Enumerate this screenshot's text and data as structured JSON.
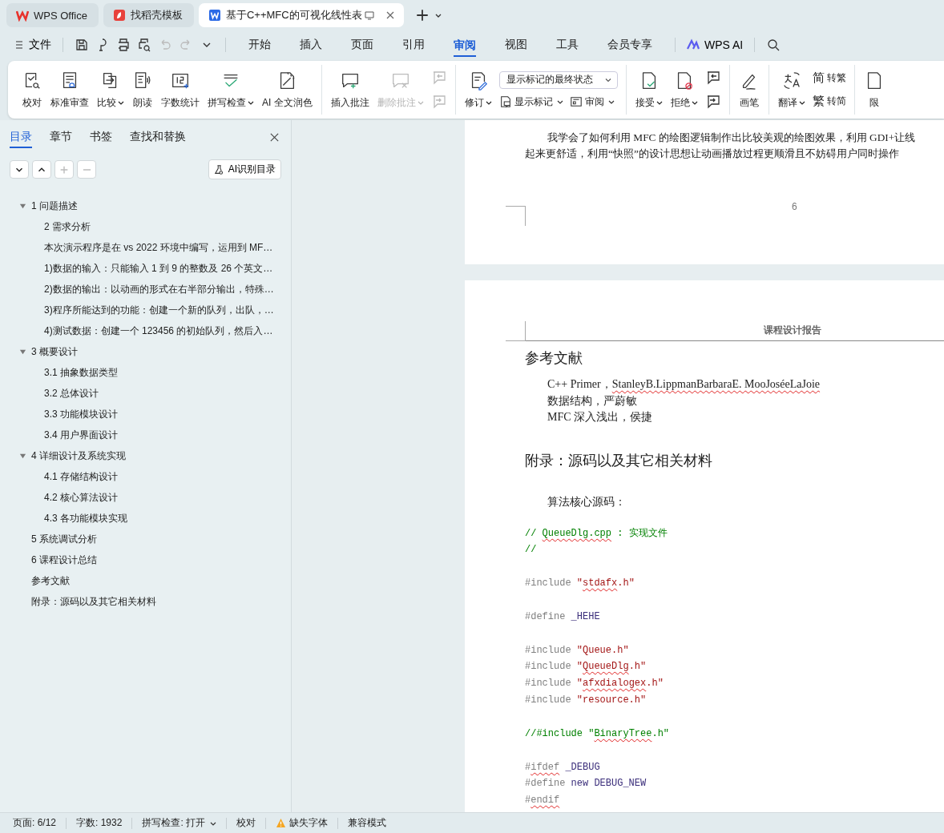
{
  "app_tabs": [
    {
      "label": "WPS Office",
      "kind": "wps",
      "selected": false
    },
    {
      "label": "找稻壳模板",
      "kind": "docer",
      "selected": false
    },
    {
      "label": "基于C++MFC的可视化线性表",
      "kind": "writer",
      "selected": true
    }
  ],
  "menu": {
    "file": "文件",
    "quick_access": [
      {
        "disabled": false
      },
      {
        "disabled": false
      },
      {
        "disabled": false
      },
      {
        "disabled": false
      },
      {
        "disabled": true
      },
      {
        "disabled": true
      }
    ],
    "tabs": [
      {
        "label": "开始",
        "selected": false
      },
      {
        "label": "插入",
        "selected": false
      },
      {
        "label": "页面",
        "selected": false
      },
      {
        "label": "引用",
        "selected": false
      },
      {
        "label": "审阅",
        "selected": true
      },
      {
        "label": "视图",
        "selected": false
      },
      {
        "label": "工具",
        "selected": false
      },
      {
        "label": "会员专享",
        "selected": false
      }
    ],
    "ai": "WPS AI"
  },
  "ribbon": {
    "groups": [
      [
        {
          "kind": "large",
          "label": "校对",
          "dropdown": false,
          "disabled": false
        },
        {
          "kind": "large",
          "label": "标准审查",
          "dropdown": false,
          "disabled": false
        },
        {
          "kind": "large",
          "label": "比较",
          "dropdown": true,
          "disabled": false
        },
        {
          "kind": "large",
          "label": "朗读",
          "dropdown": false,
          "disabled": false
        },
        {
          "kind": "large",
          "label": "字数统计",
          "dropdown": false,
          "disabled": false
        },
        {
          "kind": "large",
          "label": "拼写检查",
          "dropdown": true,
          "disabled": false
        },
        {
          "kind": "large",
          "label": "AI 全文润色",
          "dropdown": false,
          "disabled": false
        }
      ],
      [
        {
          "kind": "large",
          "label": "插入批注",
          "dropdown": false,
          "disabled": false
        },
        {
          "kind": "large",
          "label": "删除批注",
          "dropdown": true,
          "disabled": true
        },
        {
          "kind": "icon-stack",
          "disabled": true
        }
      ],
      [
        {
          "kind": "large",
          "label": "修订",
          "dropdown": true,
          "disabled": false
        },
        {
          "kind": "select-stack",
          "value": "显示标记的最终状态",
          "buttons": [
            {
              "label": "显示标记",
              "dropdown": true
            },
            {
              "label": "审阅",
              "dropdown": true
            }
          ]
        }
      ],
      [
        {
          "kind": "large",
          "label": "接受",
          "dropdown": true,
          "disabled": false
        },
        {
          "kind": "large",
          "label": "拒绝",
          "dropdown": true,
          "disabled": false
        },
        {
          "kind": "icon-stack",
          "disabled": false
        }
      ],
      [
        {
          "kind": "large",
          "label": "画笔",
          "dropdown": false,
          "disabled": false
        }
      ],
      [
        {
          "kind": "large",
          "label": "翻译",
          "dropdown": true,
          "disabled": false
        },
        {
          "kind": "text-stack",
          "buttons": [
            {
              "glyph": "简",
              "label": "转繁"
            },
            {
              "glyph": "繁",
              "label": "转简"
            }
          ]
        }
      ],
      [
        {
          "kind": "large",
          "label": "限",
          "dropdown": false,
          "disabled": false
        }
      ]
    ]
  },
  "sidebar": {
    "tabs": [
      {
        "label": "目录",
        "selected": true
      },
      {
        "label": "章节",
        "selected": false
      },
      {
        "label": "书签",
        "selected": false
      },
      {
        "label": "查找和替换",
        "selected": false
      }
    ],
    "tools": [
      {
        "kind": "down",
        "disabled": false
      },
      {
        "kind": "up",
        "disabled": false
      },
      {
        "kind": "plus",
        "disabled": true
      },
      {
        "kind": "minus",
        "disabled": true
      }
    ],
    "ai_button": "AI识别目录",
    "tree": [
      {
        "label": "1  问题描述",
        "expanded": true,
        "children": [
          {
            "label": "2  需求分析"
          },
          {
            "label": "本次演示程序是在 vs 2022 环境中编写，运用到 MF…"
          },
          {
            "label": "1)数据的输入：只能输入 1 到 9 的整数及 26 个英文…"
          },
          {
            "label": "2)数据的输出：以动画的形式在右半部分输出，特殊…"
          },
          {
            "label": "3)程序所能达到的功能：创建一个新的队列，出队，…"
          },
          {
            "label": "4)测试数据：创建一个 123456 的初始队列，然后入…"
          }
        ]
      },
      {
        "label": "3  概要设计",
        "expanded": true,
        "children": [
          {
            "label": "3.1 抽象数据类型"
          },
          {
            "label": "3.2  总体设计"
          },
          {
            "label": "3.3  功能模块设计"
          },
          {
            "label": "3.4  用户界面设计"
          }
        ]
      },
      {
        "label": "4  详细设计及系统实现",
        "expanded": true,
        "children": [
          {
            "label": "4.1  存储结构设计"
          },
          {
            "label": "4.2  核心算法设计"
          },
          {
            "label": "4.3  各功能模块实现"
          }
        ]
      },
      {
        "label": "5  系统调试分析"
      },
      {
        "label": "6  课程设计总结"
      },
      {
        "label": "参考文献"
      },
      {
        "label": "附录：源码以及其它相关材料"
      }
    ]
  },
  "document": {
    "page_prev": {
      "lines": [
        {
          "text": "我学会了如何利用 MFC 的绘图逻辑制作出比较美观的绘图效果，利用 GDI+让线",
          "indent": true
        },
        {
          "text": "起来更舒适，利用“快照”的设计思想让动画播放过程更顺滑且不妨碍用户同时操作",
          "indent": false
        }
      ],
      "page_number": "6"
    },
    "page": {
      "header": "课程设计报告",
      "heading_refs": "参考文献",
      "references": [
        {
          "parts": [
            {
              "text": "C++ Primer，",
              "misspelled": false
            },
            {
              "text": "StanleyB.LippmanBarbaraE. MooJoséeLaJoie",
              "misspelled": true
            }
          ]
        },
        {
          "text": "数据结构，严蔚敏"
        },
        {
          "text": "MFC 深入浅出，侯捷"
        }
      ],
      "heading_appendix": "附录：源码以及其它相关材料",
      "intro": "算法核心源码：",
      "code_blocks": [
        [
          [
            {
              "text": "// ",
              "kind": "comment",
              "misspelled": false
            },
            {
              "text": "QueueDlg.cpp",
              "kind": "comment",
              "misspelled": true
            },
            {
              "text": " : 实现文件",
              "kind": "comment",
              "misspelled": false
            }
          ],
          [
            {
              "text": "//",
              "kind": "comment",
              "misspelled": false
            }
          ]
        ],
        [
          [
            {
              "text": "#include ",
              "kind": "directive",
              "misspelled": false
            },
            {
              "text": "\"",
              "kind": "string",
              "misspelled": false
            },
            {
              "text": "stdafx",
              "kind": "string",
              "misspelled": true
            },
            {
              "text": ".h\"",
              "kind": "string",
              "misspelled": false
            }
          ]
        ],
        [
          [
            {
              "text": "#define ",
              "kind": "directive",
              "misspelled": false
            },
            {
              "text": "_HEHE",
              "kind": "macro",
              "misspelled": false
            }
          ]
        ],
        [
          [
            {
              "text": "#include ",
              "kind": "directive",
              "misspelled": false
            },
            {
              "text": "\"Queue.h\"",
              "kind": "string",
              "misspelled": false
            }
          ],
          [
            {
              "text": "#include ",
              "kind": "directive",
              "misspelled": false
            },
            {
              "text": "\"",
              "kind": "string",
              "misspelled": false
            },
            {
              "text": "QueueDlg",
              "kind": "string",
              "misspelled": true
            },
            {
              "text": ".h\"",
              "kind": "string",
              "misspelled": false
            }
          ],
          [
            {
              "text": "#include ",
              "kind": "directive",
              "misspelled": false
            },
            {
              "text": "\"",
              "kind": "string",
              "misspelled": false
            },
            {
              "text": "afxdialogex",
              "kind": "string",
              "misspelled": true
            },
            {
              "text": ".h\"",
              "kind": "string",
              "misspelled": false
            }
          ],
          [
            {
              "text": "#include ",
              "kind": "directive",
              "misspelled": false
            },
            {
              "text": "\"resource.h\"",
              "kind": "string",
              "misspelled": false
            }
          ]
        ],
        [
          [
            {
              "text": "//#include \"",
              "kind": "comment",
              "misspelled": false
            },
            {
              "text": "BinaryTree",
              "kind": "comment",
              "misspelled": true
            },
            {
              "text": ".h\"",
              "kind": "comment",
              "misspelled": false
            }
          ]
        ],
        [
          [
            {
              "text": "#",
              "kind": "directive",
              "misspelled": false
            },
            {
              "text": "ifdef",
              "kind": "directive",
              "misspelled": true
            },
            {
              "text": " _DEBUG",
              "kind": "macro",
              "misspelled": false
            }
          ],
          [
            {
              "text": "#define ",
              "kind": "directive",
              "misspelled": false
            },
            {
              "text": "new DEBUG_NEW",
              "kind": "macro",
              "misspelled": false
            }
          ],
          [
            {
              "text": "#",
              "kind": "directive",
              "misspelled": false
            },
            {
              "text": "endif",
              "kind": "directive",
              "misspelled": true
            }
          ]
        ]
      ]
    }
  },
  "status_bar": [
    {
      "kind": "text",
      "text": "页面: 6/12"
    },
    {
      "kind": "text",
      "text": "字数: 1932"
    },
    {
      "kind": "dropdown",
      "text": "拼写检查: 打开"
    },
    {
      "kind": "text",
      "text": "校对"
    },
    {
      "kind": "warning",
      "text": "缺失字体"
    },
    {
      "kind": "text",
      "text": "兼容模式"
    }
  ]
}
